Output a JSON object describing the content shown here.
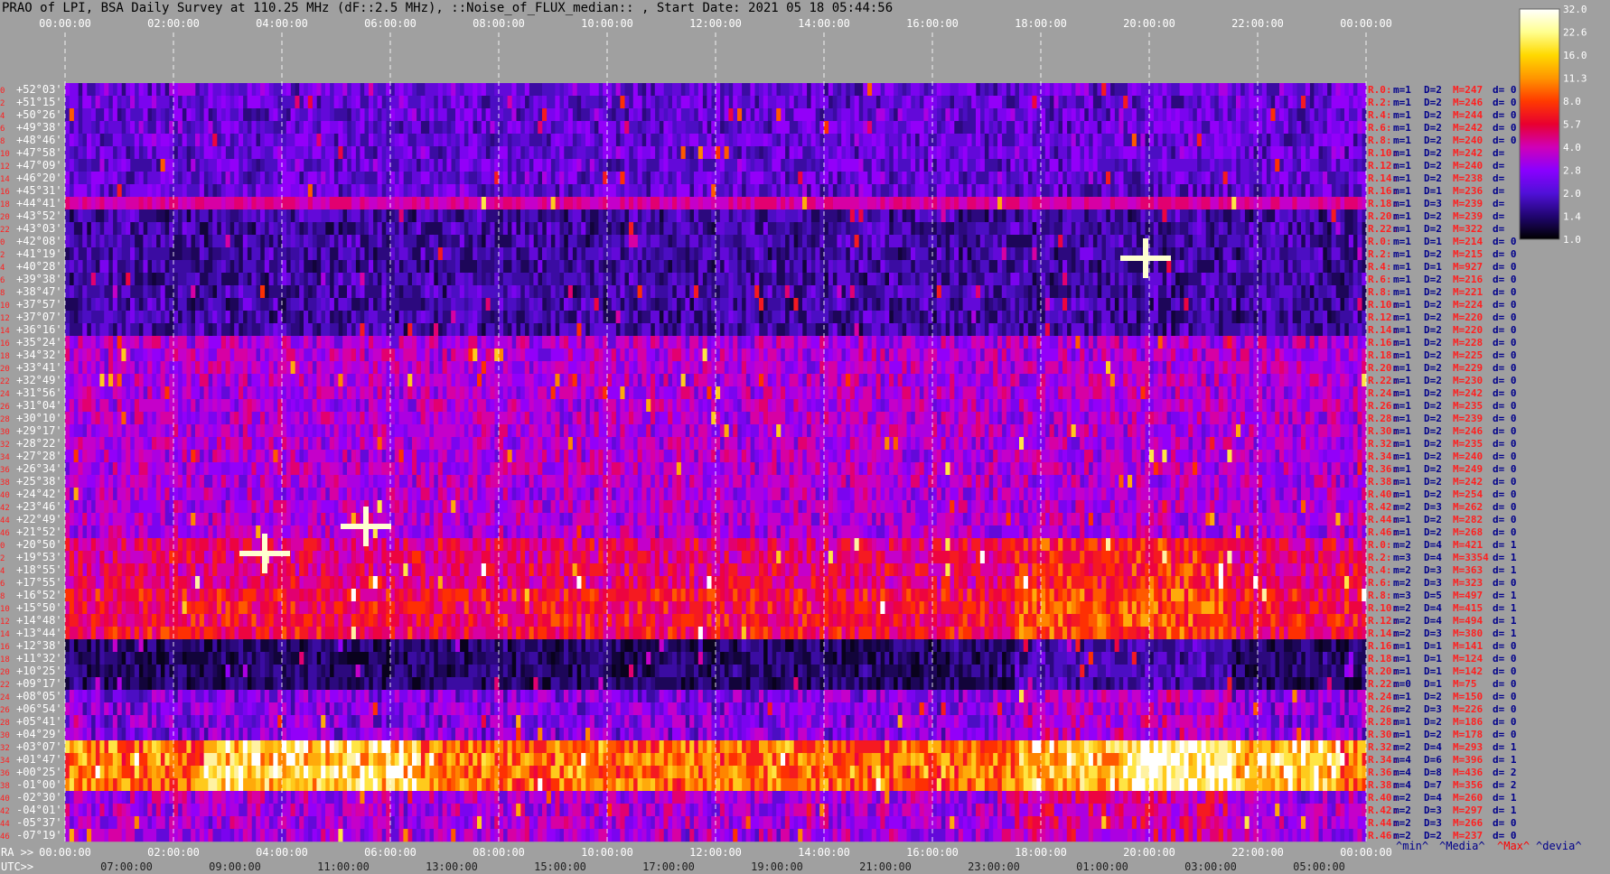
{
  "title": "PRAO of LPI, BSA Daily Survey at 110.25 MHz (dF::2.5 MHz), ::Noise_of_FLUX_median:: , Start Date: 2021 05 18 05:44:56",
  "chart_data": {
    "type": "heatmap",
    "top_time_ticks": [
      "00:00:00",
      "02:00:00",
      "04:00:00",
      "06:00:00",
      "08:00:00",
      "10:00:00",
      "12:00:00",
      "14:00:00",
      "16:00:00",
      "18:00:00",
      "20:00:00",
      "22:00:00",
      "00:00:00"
    ],
    "ra_prefix": "RA >>",
    "ra_ticks": [
      "00:00:00",
      "02:00:00",
      "04:00:00",
      "06:00:00",
      "08:00:00",
      "10:00:00",
      "12:00:00",
      "14:00:00",
      "16:00:00",
      "18:00:00",
      "20:00:00",
      "22:00:00",
      "00:00:00"
    ],
    "utc_prefix": "UTC>>",
    "utc_ticks": [
      "07:00:00",
      "09:00:00",
      "11:00:00",
      "13:00:00",
      "15:00:00",
      "17:00:00",
      "19:00:00",
      "21:00:00",
      "23:00:00",
      "01:00:00",
      "03:00:00",
      "05:00:00"
    ],
    "colorbar_ticks": [
      "32.0",
      "22.6",
      "16.0",
      "11.3",
      "8.0",
      "5.7",
      "4.0",
      "2.8",
      "2.0",
      "1.4",
      "1.0"
    ],
    "colorbar_colors": [
      "#ffffff",
      "#ffff90",
      "#ffd900",
      "#ff9500",
      "#ff3a00",
      "#e80030",
      "#d000b8",
      "#8a00ff",
      "#5010d8",
      "#200570",
      "#000000"
    ],
    "legend_labels": [
      "^min^",
      "^Media^",
      "^Max^",
      "^devia^"
    ],
    "legend_colors": [
      "#00008b",
      "#00008b",
      "#ff0000",
      "#00008b"
    ],
    "dec_labels": [
      "+52°03'",
      "+51°15'",
      "+50°26'",
      "+49°38'",
      "+48°46'",
      "+47°58'",
      "+47°09'",
      "+46°20'",
      "+45°31'",
      "+44°41'",
      "+43°52'",
      "+43°03'",
      "+42°08'",
      "+41°19'",
      "+40°28'",
      "+39°38'",
      "+38°47'",
      "+37°57'",
      "+37°07'",
      "+36°16'",
      "+35°24'",
      "+34°32'",
      "+33°41'",
      "+32°49'",
      "+31°56'",
      "+31°04'",
      "+30°10'",
      "+29°17'",
      "+28°22'",
      "+27°28'",
      "+26°34'",
      "+25°38'",
      "+24°42'",
      "+23°46'",
      "+22°49'",
      "+21°52'",
      "+20°50'",
      "+19°53'",
      "+18°55'",
      "+17°55'",
      "+16°52'",
      "+15°50'",
      "+14°48'",
      "+13°44'",
      "+12°38'",
      "+11°32'",
      "+10°25'",
      "+09°17'",
      "+08°05'",
      "+06°54'",
      "+05°41'",
      "+04°29'",
      "+03°07'",
      "+01°47'",
      "+00°25'",
      "-01°00'",
      "-02°30'",
      "-04°01'",
      "-05°37'",
      "-07°19'"
    ],
    "beam_numbers": [
      "0",
      "2",
      "4",
      "6",
      "8",
      "10",
      "12",
      "14",
      "16",
      "18",
      "20",
      "22",
      "0",
      "2",
      "4",
      "6",
      "8",
      "10",
      "12",
      "14",
      "16",
      "18",
      "20",
      "22",
      "24",
      "26",
      "28",
      "30",
      "32",
      "34",
      "36",
      "38",
      "40",
      "42",
      "44",
      "46",
      "0",
      "2",
      "4",
      "6",
      "8",
      "10",
      "12",
      "14",
      "16",
      "18",
      "20",
      "22",
      "24",
      "26",
      "28",
      "30",
      "32",
      "34",
      "36",
      "38",
      "40",
      "42",
      "44",
      "46"
    ],
    "right_stats": [
      [
        "R.0:",
        "m=1",
        "D=2",
        "M=247",
        "d= 0"
      ],
      [
        "R.2:",
        "m=1",
        "D=2",
        "M=246",
        "d= 0"
      ],
      [
        "R.4:",
        "m=1",
        "D=2",
        "M=244",
        "d= 0"
      ],
      [
        "R.6:",
        "m=1",
        "D=2",
        "M=242",
        "d= 0"
      ],
      [
        "R.8:",
        "m=1",
        "D=2",
        "M=240",
        "d= 0"
      ],
      [
        "R.10:",
        "m=1",
        "D=2",
        "M=242",
        "d="
      ],
      [
        "R.12:",
        "m=1",
        "D=2",
        "M=240",
        "d="
      ],
      [
        "R.14:",
        "m=1",
        "D=2",
        "M=238",
        "d="
      ],
      [
        "R.16:",
        "m=1",
        "D=1",
        "M=236",
        "d="
      ],
      [
        "R.18:",
        "m=1",
        "D=3",
        "M=239",
        "d="
      ],
      [
        "R.20:",
        "m=1",
        "D=2",
        "M=239",
        "d="
      ],
      [
        "R.22:",
        "m=1",
        "D=2",
        "M=322",
        "d="
      ],
      [
        "R.0:",
        "m=1",
        "D=1",
        "M=214",
        "d= 0"
      ],
      [
        "R.2:",
        "m=1",
        "D=2",
        "M=215",
        "d= 0"
      ],
      [
        "R.4:",
        "m=1",
        "D=1",
        "M=927",
        "d= 0"
      ],
      [
        "R.6:",
        "m=1",
        "D=2",
        "M=216",
        "d= 0"
      ],
      [
        "R.8:",
        "m=1",
        "D=2",
        "M=221",
        "d= 0"
      ],
      [
        "R.10:",
        "m=1",
        "D=2",
        "M=224",
        "d= 0"
      ],
      [
        "R.12:",
        "m=1",
        "D=2",
        "M=220",
        "d= 0"
      ],
      [
        "R.14:",
        "m=1",
        "D=2",
        "M=220",
        "d= 0"
      ],
      [
        "R.16:",
        "m=1",
        "D=2",
        "M=228",
        "d= 0"
      ],
      [
        "R.18:",
        "m=1",
        "D=2",
        "M=225",
        "d= 0"
      ],
      [
        "R.20:",
        "m=1",
        "D=2",
        "M=229",
        "d= 0"
      ],
      [
        "R.22:",
        "m=1",
        "D=2",
        "M=230",
        "d= 0"
      ],
      [
        "R.24:",
        "m=1",
        "D=2",
        "M=242",
        "d= 0"
      ],
      [
        "R.26:",
        "m=1",
        "D=2",
        "M=235",
        "d= 0"
      ],
      [
        "R.28:",
        "m=1",
        "D=2",
        "M=239",
        "d= 0"
      ],
      [
        "R.30:",
        "m=1",
        "D=2",
        "M=246",
        "d= 0"
      ],
      [
        "R.32:",
        "m=1",
        "D=2",
        "M=235",
        "d= 0"
      ],
      [
        "R.34:",
        "m=1",
        "D=2",
        "M=240",
        "d= 0"
      ],
      [
        "R.36:",
        "m=1",
        "D=2",
        "M=249",
        "d= 0"
      ],
      [
        "R.38:",
        "m=1",
        "D=2",
        "M=242",
        "d= 0"
      ],
      [
        "R.40:",
        "m=1",
        "D=2",
        "M=254",
        "d= 0"
      ],
      [
        "R.42:",
        "m=2",
        "D=3",
        "M=262",
        "d= 0"
      ],
      [
        "R.44:",
        "m=1",
        "D=2",
        "M=282",
        "d= 0"
      ],
      [
        "R.46:",
        "m=1",
        "D=2",
        "M=268",
        "d= 0"
      ],
      [
        "R.0:",
        "m=2",
        "D=4",
        "M=421",
        "d= 1"
      ],
      [
        "R.2:",
        "m=3",
        "D=4",
        "M=3354",
        "d= 1"
      ],
      [
        "R.4:",
        "m=2",
        "D=3",
        "M=363",
        "d= 1"
      ],
      [
        "R.6:",
        "m=2",
        "D=3",
        "M=323",
        "d= 0"
      ],
      [
        "R.8:",
        "m=3",
        "D=5",
        "M=497",
        "d= 1"
      ],
      [
        "R.10:",
        "m=2",
        "D=4",
        "M=415",
        "d= 1"
      ],
      [
        "R.12:",
        "m=2",
        "D=4",
        "M=494",
        "d= 1"
      ],
      [
        "R.14:",
        "m=2",
        "D=3",
        "M=380",
        "d= 1"
      ],
      [
        "R.16:",
        "m=1",
        "D=1",
        "M=141",
        "d= 0"
      ],
      [
        "R.18:",
        "m=1",
        "D=1",
        "M=124",
        "d= 0"
      ],
      [
        "R.20:",
        "m=1",
        "D=1",
        "M=142",
        "d= 0"
      ],
      [
        "R.22:",
        "m=0",
        "D=1",
        "M=75",
        "d= 0"
      ],
      [
        "R.24:",
        "m=1",
        "D=2",
        "M=150",
        "d= 0"
      ],
      [
        "R.26:",
        "m=2",
        "D=3",
        "M=226",
        "d= 0"
      ],
      [
        "R.28:",
        "m=1",
        "D=2",
        "M=186",
        "d= 0"
      ],
      [
        "R.30:",
        "m=1",
        "D=2",
        "M=178",
        "d= 0"
      ],
      [
        "R.32:",
        "m=2",
        "D=4",
        "M=293",
        "d= 1"
      ],
      [
        "R.34:",
        "m=4",
        "D=6",
        "M=396",
        "d= 1"
      ],
      [
        "R.36:",
        "m=4",
        "D=8",
        "M=436",
        "d= 2"
      ],
      [
        "R.38:",
        "m=4",
        "D=7",
        "M=356",
        "d= 2"
      ],
      [
        "R.40:",
        "m=2",
        "D=4",
        "M=260",
        "d= 1"
      ],
      [
        "R.42:",
        "m=2",
        "D=3",
        "M=297",
        "d= 1"
      ],
      [
        "R.44:",
        "m=2",
        "D=3",
        "M=266",
        "d= 0"
      ],
      [
        "R.46:",
        "m=2",
        "D=2",
        "M=237",
        "d= 0"
      ]
    ]
  }
}
